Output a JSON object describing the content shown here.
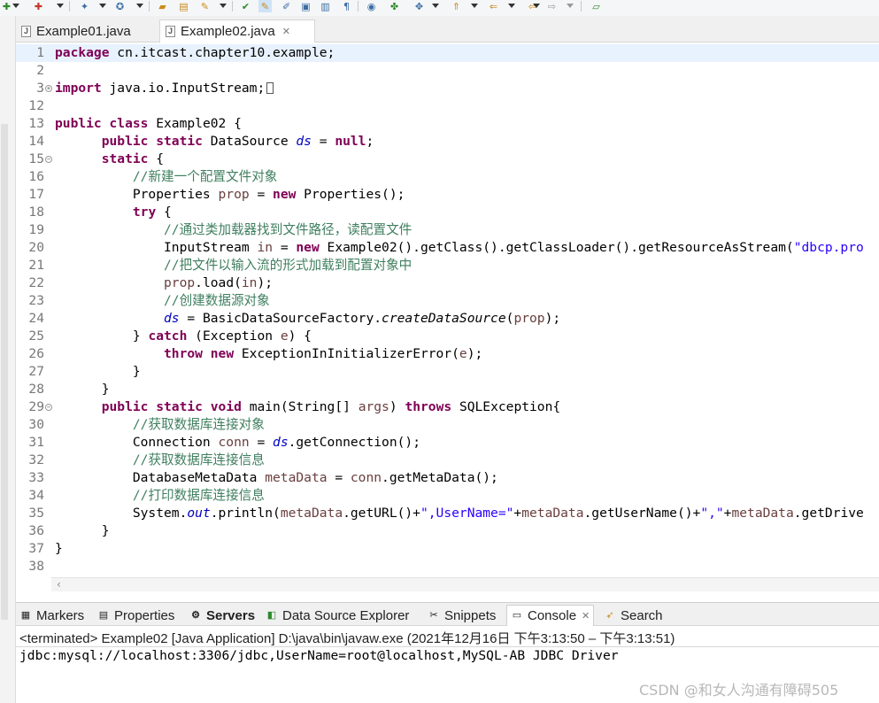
{
  "editor_tabs": [
    {
      "label": "Example01.java",
      "active": false
    },
    {
      "label": "Example02.java",
      "active": true
    }
  ],
  "code_lines": [
    {
      "num": "1",
      "current": true,
      "segments": [
        {
          "t": "package",
          "c": "kw"
        },
        {
          "t": " cn.itcast.chapter10.example;"
        }
      ]
    },
    {
      "num": "2",
      "segments": []
    },
    {
      "num": "3",
      "fold": "+",
      "segments": [
        {
          "t": "import",
          "c": "kw"
        },
        {
          "t": " java.io.InputStream;"
        },
        {
          "t": "",
          "c": "boxcol"
        }
      ]
    },
    {
      "num": "12",
      "segments": []
    },
    {
      "num": "13",
      "segments": [
        {
          "t": "public",
          "c": "kw"
        },
        {
          "t": " "
        },
        {
          "t": "class",
          "c": "kw"
        },
        {
          "t": " Example02 {"
        }
      ]
    },
    {
      "num": "14",
      "segments": [
        {
          "t": "      "
        },
        {
          "t": "public",
          "c": "kw"
        },
        {
          "t": " "
        },
        {
          "t": "static",
          "c": "kw"
        },
        {
          "t": " DataSource "
        },
        {
          "t": "ds",
          "c": "fld"
        },
        {
          "t": " = "
        },
        {
          "t": "null",
          "c": "kw"
        },
        {
          "t": ";"
        }
      ]
    },
    {
      "num": "15",
      "fold": "-",
      "segments": [
        {
          "t": "      "
        },
        {
          "t": "static",
          "c": "kw"
        },
        {
          "t": " {"
        }
      ]
    },
    {
      "num": "16",
      "segments": [
        {
          "t": "          "
        },
        {
          "t": "//新建一个配置文件对象",
          "c": "cm"
        }
      ]
    },
    {
      "num": "17",
      "segments": [
        {
          "t": "          Properties "
        },
        {
          "t": "prop",
          "c": "var"
        },
        {
          "t": " = "
        },
        {
          "t": "new",
          "c": "kw"
        },
        {
          "t": " Properties();"
        }
      ]
    },
    {
      "num": "18",
      "segments": [
        {
          "t": "          "
        },
        {
          "t": "try",
          "c": "kw"
        },
        {
          "t": " {"
        }
      ]
    },
    {
      "num": "19",
      "segments": [
        {
          "t": "              "
        },
        {
          "t": "//通过类加载器找到文件路径，读配置文件",
          "c": "cm"
        }
      ]
    },
    {
      "num": "20",
      "segments": [
        {
          "t": "              InputStream "
        },
        {
          "t": "in",
          "c": "var"
        },
        {
          "t": " = "
        },
        {
          "t": "new",
          "c": "kw"
        },
        {
          "t": " Example02().getClass().getClassLoader().getResourceAsStream("
        },
        {
          "t": "\"dbcp.pro",
          "c": "st"
        }
      ]
    },
    {
      "num": "21",
      "segments": [
        {
          "t": "              "
        },
        {
          "t": "//把文件以输入流的形式加载到配置对象中",
          "c": "cm"
        }
      ]
    },
    {
      "num": "22",
      "segments": [
        {
          "t": "              "
        },
        {
          "t": "prop",
          "c": "var"
        },
        {
          "t": ".load("
        },
        {
          "t": "in",
          "c": "var"
        },
        {
          "t": ");"
        }
      ]
    },
    {
      "num": "23",
      "segments": [
        {
          "t": "              "
        },
        {
          "t": "//创建数据源对象",
          "c": "cm"
        }
      ]
    },
    {
      "num": "24",
      "segments": [
        {
          "t": "              "
        },
        {
          "t": "ds",
          "c": "fld"
        },
        {
          "t": " = BasicDataSourceFactory."
        },
        {
          "t": "createDataSource",
          "c": "ital"
        },
        {
          "t": "("
        },
        {
          "t": "prop",
          "c": "var"
        },
        {
          "t": ");"
        }
      ]
    },
    {
      "num": "25",
      "segments": [
        {
          "t": "          } "
        },
        {
          "t": "catch",
          "c": "kw"
        },
        {
          "t": " (Exception "
        },
        {
          "t": "e",
          "c": "var"
        },
        {
          "t": ") {"
        }
      ]
    },
    {
      "num": "26",
      "segments": [
        {
          "t": "              "
        },
        {
          "t": "throw",
          "c": "kw"
        },
        {
          "t": " "
        },
        {
          "t": "new",
          "c": "kw"
        },
        {
          "t": " ExceptionInInitializerError("
        },
        {
          "t": "e",
          "c": "var"
        },
        {
          "t": ");"
        }
      ]
    },
    {
      "num": "27",
      "segments": [
        {
          "t": "          }"
        }
      ]
    },
    {
      "num": "28",
      "segments": [
        {
          "t": "      }"
        }
      ]
    },
    {
      "num": "29",
      "fold": "-",
      "segments": [
        {
          "t": "      "
        },
        {
          "t": "public",
          "c": "kw"
        },
        {
          "t": " "
        },
        {
          "t": "static",
          "c": "kw"
        },
        {
          "t": " "
        },
        {
          "t": "void",
          "c": "kw"
        },
        {
          "t": " main(String[] "
        },
        {
          "t": "args",
          "c": "var"
        },
        {
          "t": ") "
        },
        {
          "t": "throws",
          "c": "kw"
        },
        {
          "t": " SQLException{"
        }
      ]
    },
    {
      "num": "30",
      "segments": [
        {
          "t": "          "
        },
        {
          "t": "//获取数据库连接对象",
          "c": "cm"
        }
      ]
    },
    {
      "num": "31",
      "segments": [
        {
          "t": "          Connection "
        },
        {
          "t": "conn",
          "c": "var"
        },
        {
          "t": " = "
        },
        {
          "t": "ds",
          "c": "fld"
        },
        {
          "t": ".getConnection();"
        }
      ]
    },
    {
      "num": "32",
      "segments": [
        {
          "t": "          "
        },
        {
          "t": "//获取数据库连接信息",
          "c": "cm"
        }
      ]
    },
    {
      "num": "33",
      "segments": [
        {
          "t": "          DatabaseMetaData "
        },
        {
          "t": "metaData",
          "c": "var"
        },
        {
          "t": " = "
        },
        {
          "t": "conn",
          "c": "var"
        },
        {
          "t": ".getMetaData();"
        }
      ]
    },
    {
      "num": "34",
      "segments": [
        {
          "t": "          "
        },
        {
          "t": "//打印数据库连接信息",
          "c": "cm"
        }
      ]
    },
    {
      "num": "35",
      "segments": [
        {
          "t": "          System."
        },
        {
          "t": "out",
          "c": "fld"
        },
        {
          "t": ".println("
        },
        {
          "t": "metaData",
          "c": "var"
        },
        {
          "t": ".getURL()+"
        },
        {
          "t": "\",UserName=\"",
          "c": "st"
        },
        {
          "t": "+"
        },
        {
          "t": "metaData",
          "c": "var"
        },
        {
          "t": ".getUserName()+"
        },
        {
          "t": "\",\"",
          "c": "st"
        },
        {
          "t": "+"
        },
        {
          "t": "metaData",
          "c": "var"
        },
        {
          "t": ".getDrive"
        }
      ]
    },
    {
      "num": "36",
      "segments": [
        {
          "t": "      }"
        }
      ]
    },
    {
      "num": "37",
      "segments": [
        {
          "t": "}"
        }
      ]
    },
    {
      "num": "38",
      "segments": []
    }
  ],
  "panel_tabs": [
    {
      "id": "markers",
      "label": "Markers",
      "icon": "markers-icon",
      "glyph": "▦"
    },
    {
      "id": "properties",
      "label": "Properties",
      "icon": "properties-icon",
      "glyph": "▤"
    },
    {
      "id": "servers",
      "label": "Servers",
      "icon": "servers-icon",
      "glyph": "⚙"
    },
    {
      "id": "datasource",
      "label": "Data Source Explorer",
      "icon": "data-source-icon",
      "glyph": "◧"
    },
    {
      "id": "snippets",
      "label": "Snippets",
      "icon": "snippets-icon",
      "glyph": "✂"
    },
    {
      "id": "console",
      "label": "Console",
      "icon": "console-icon",
      "glyph": "▭"
    },
    {
      "id": "search",
      "label": "Search",
      "icon": "search-icon",
      "glyph": "➶"
    }
  ],
  "console": {
    "status": "<terminated> Example02 [Java Application] D:\\java\\bin\\javaw.exe  (2021年12月16日 下午3:13:50 – 下午3:13:51)",
    "output": "jdbc:mysql://localhost:3306/jdbc,UserName=root@localhost,MySQL-AB JDBC Driver"
  },
  "watermark": "CSDN @和女人沟通有障碍505",
  "colors": {
    "keyword": "#7f0055",
    "comment": "#3f7f5f",
    "string": "#2a00ff",
    "field": "#0000c0",
    "local_variable": "#6a3e3e"
  }
}
